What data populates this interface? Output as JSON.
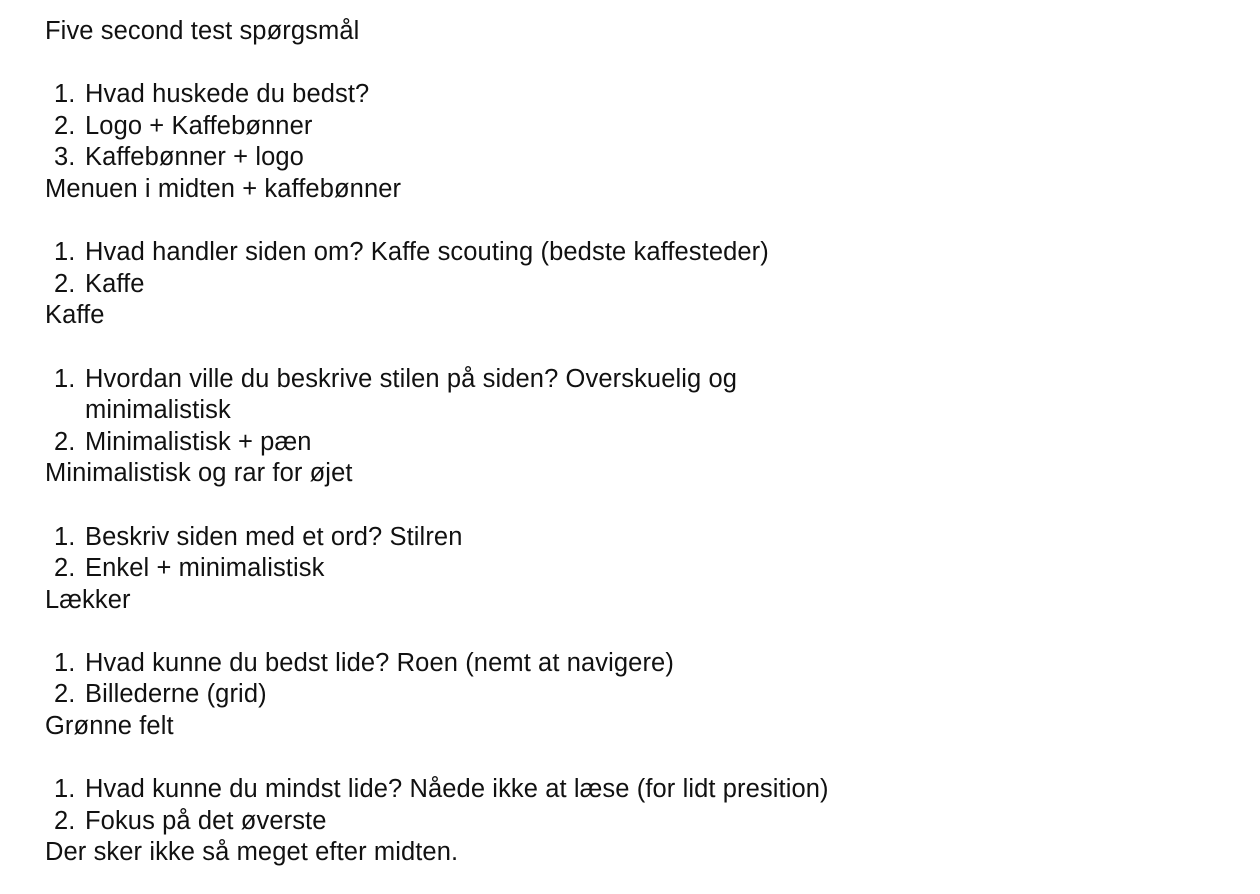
{
  "document": {
    "title": "Five second test spørgsmål",
    "sections": [
      {
        "items": [
          {
            "num": "1.",
            "text": "Hvad huskede du bedst?"
          },
          {
            "num": "2.",
            "text": "Logo + Kaffebønner"
          },
          {
            "num": "3.",
            "text": "Kaffebønner + logo"
          }
        ],
        "answer": "Menuen i midten + kaffebønner"
      },
      {
        "items": [
          {
            "num": "1.",
            "text": "Hvad handler siden om? Kaffe scouting (bedste kaffesteder)"
          },
          {
            "num": "2.",
            "text": "Kaffe"
          }
        ],
        "answer": "Kaffe"
      },
      {
        "items": [
          {
            "num": "1.",
            "text": "Hvordan ville du beskrive stilen på siden? Overskuelig og minimalistisk"
          },
          {
            "num": "2.",
            "text": "Minimalistisk + pæn"
          }
        ],
        "answer": "Minimalistisk og rar for øjet"
      },
      {
        "items": [
          {
            "num": "1.",
            "text": "Beskriv siden med et ord? Stilren"
          },
          {
            "num": "2.",
            "text": "Enkel + minimalistisk"
          }
        ],
        "answer": "Lækker"
      },
      {
        "items": [
          {
            "num": "1.",
            "text": "Hvad kunne du bedst lide? Roen (nemt at navigere)"
          },
          {
            "num": "2.",
            "text": "Billederne (grid)"
          }
        ],
        "answer": "Grønne felt"
      },
      {
        "items": [
          {
            "num": "1.",
            "text": "Hvad kunne du mindst lide? Nåede ikke at læse (for lidt presition)"
          },
          {
            "num": "2.",
            "text": "Fokus på det øverste"
          }
        ],
        "answer": "Der sker ikke så meget efter midten."
      }
    ]
  }
}
